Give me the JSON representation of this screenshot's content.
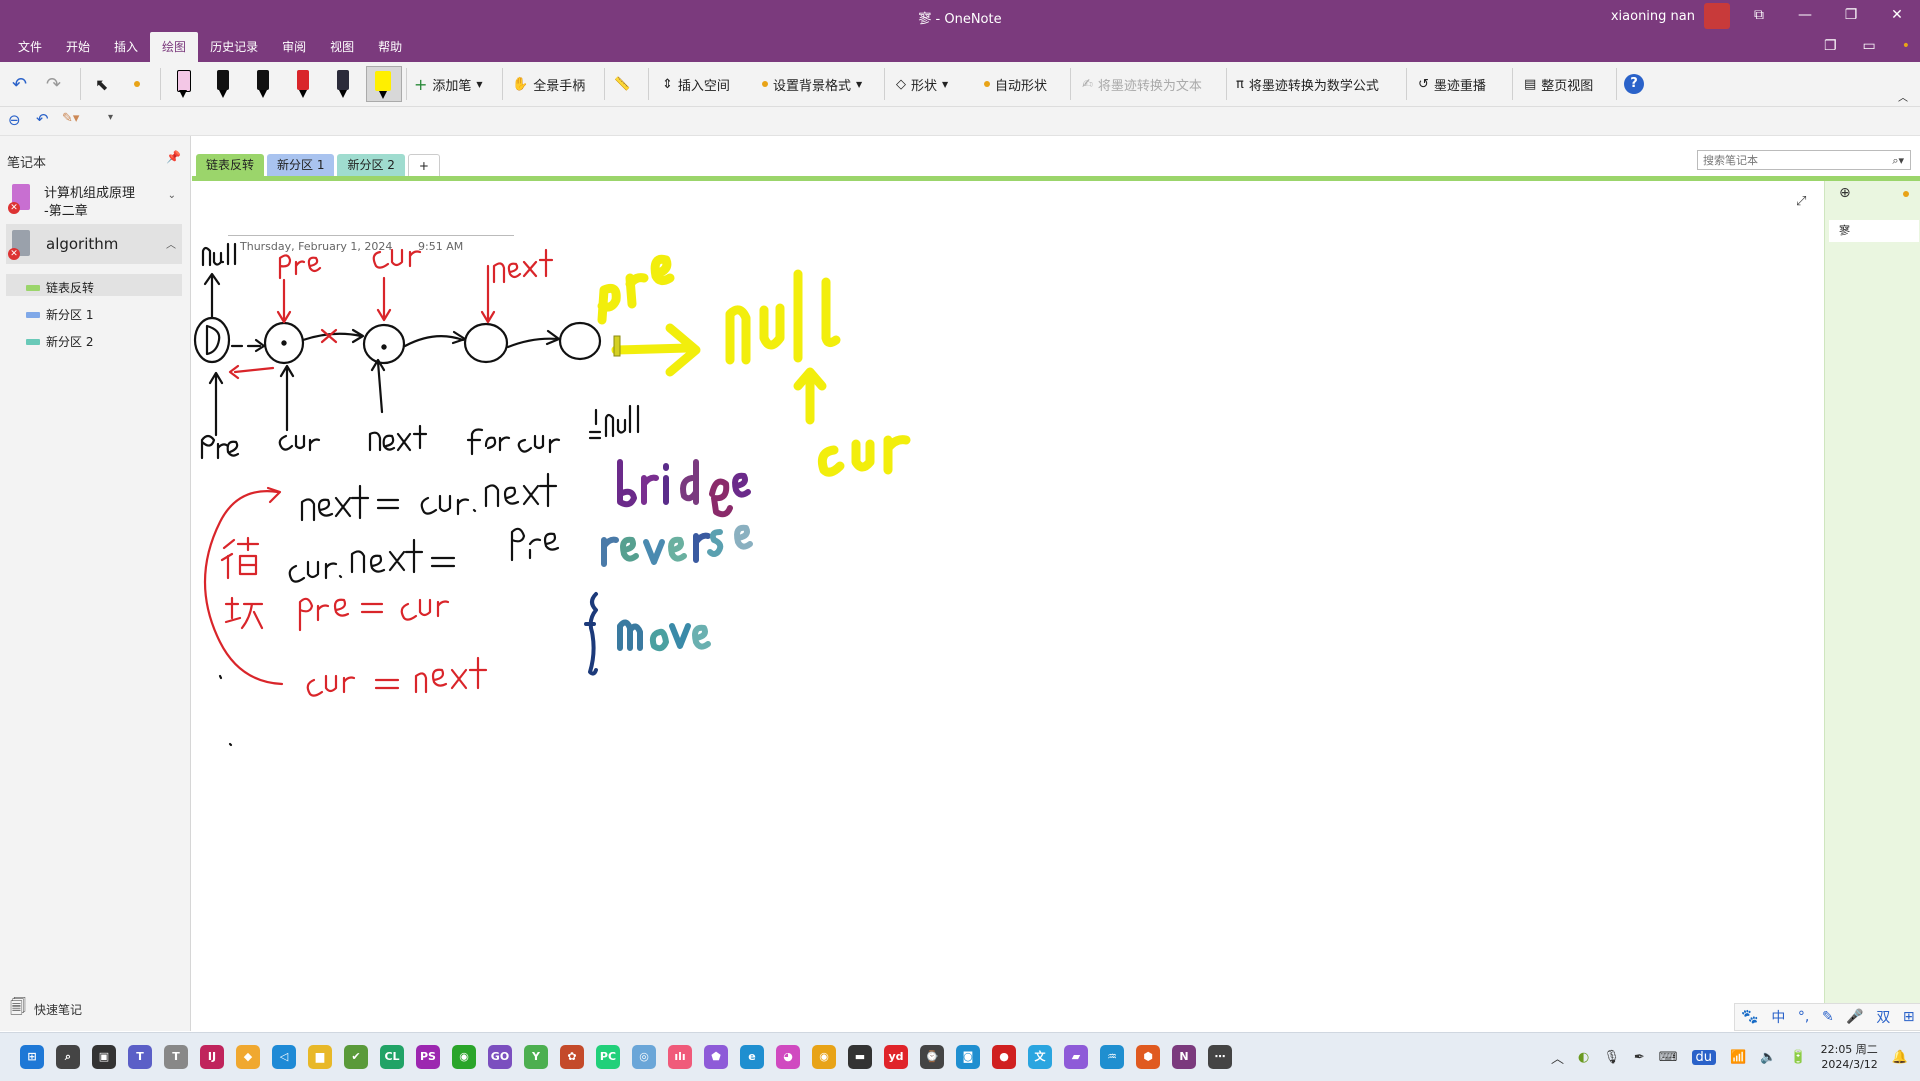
{
  "window": {
    "title": "寥 - OneNote",
    "user": "xiaoning nan",
    "controls": [
      "⧉",
      "—",
      "❐",
      "✕"
    ]
  },
  "menu": {
    "tabs": [
      "文件",
      "开始",
      "插入",
      "绘图",
      "历史记录",
      "审阅",
      "视图",
      "帮助"
    ],
    "active_index": 3
  },
  "ribbon": {
    "add_pen": "添加笔",
    "full_hand": "全景手柄",
    "insert_space": "插入空间",
    "bg_format": "设置背景格式",
    "shapes": "形状",
    "auto_shapes": "自动形状",
    "ink_to_text": "将墨迹转换为文本",
    "ink_to_math": "将墨迹转换为数学公式",
    "ink_replay": "墨迹重播",
    "page_view": "整页视图",
    "help": "?"
  },
  "sidebar": {
    "header": "笔记本",
    "notebooks": [
      {
        "name_line1": "计算机组成原理",
        "name_line2": "-第二章",
        "color": "#c86fd1"
      },
      {
        "name": "algorithm",
        "color": "#9aa1ab"
      }
    ],
    "sections": [
      {
        "label": "链表反转",
        "color": "#9bd56b"
      },
      {
        "label": "新分区 1",
        "color": "#7fa8e8"
      },
      {
        "label": "新分区 2",
        "color": "#69c9b8"
      }
    ],
    "quick_notes": "快速笔记"
  },
  "section_tabs": [
    {
      "label": "链表反转",
      "bg": "#9bd56b"
    },
    {
      "label": "新分区 1",
      "bg": "#a9c3ef"
    },
    {
      "label": "新分区 2",
      "bg": "#9fdccf"
    },
    {
      "label": "+",
      "bg": "#ffffff"
    }
  ],
  "search": {
    "placeholder": "搜索笔记本"
  },
  "page": {
    "date": "Thursday, February 1, 2024",
    "time": "9:51 AM"
  },
  "page_list": {
    "add": "⊕",
    "pages": [
      "寥"
    ]
  },
  "ime": [
    "🐾",
    "中",
    "°,",
    "✎",
    "🎤",
    "双",
    "⊞"
  ],
  "taskbar": {
    "time": "22:05 周二",
    "date": "2024/3/12",
    "apps": [
      {
        "label": "⊞",
        "color": "#1e78d6"
      },
      {
        "label": "⌕",
        "color": "#444444"
      },
      {
        "label": "▣",
        "color": "#333333"
      },
      {
        "label": "T",
        "color": "#5b5fc7"
      },
      {
        "label": "T",
        "color": "#888888"
      },
      {
        "label": "IJ",
        "color": "#c0245c"
      },
      {
        "label": "◆",
        "color": "#f0a830"
      },
      {
        "label": "◁",
        "color": "#1e8ad6"
      },
      {
        "label": "▆",
        "color": "#e8b828"
      },
      {
        "label": "✔",
        "color": "#5a9a3a"
      },
      {
        "label": "CL",
        "color": "#21a366"
      },
      {
        "label": "PS",
        "color": "#9c27b0"
      },
      {
        "label": "◉",
        "color": "#2aa52a"
      },
      {
        "label": "GO",
        "color": "#7b4fbf"
      },
      {
        "label": "Y",
        "color": "#4caf50"
      },
      {
        "label": "✿",
        "color": "#c44a2a"
      },
      {
        "label": "PC",
        "color": "#21d07a"
      },
      {
        "label": "◎",
        "color": "#6aa6d8"
      },
      {
        "label": "ılı",
        "color": "#f05a7a"
      },
      {
        "label": "⬟",
        "color": "#8e5bd8"
      },
      {
        "label": "e",
        "color": "#1f8fd0"
      },
      {
        "label": "◕",
        "color": "#d04ac0"
      },
      {
        "label": "◉",
        "color": "#e8a317"
      },
      {
        "label": "▬",
        "color": "#333333"
      },
      {
        "label": "yd",
        "color": "#e0242a"
      },
      {
        "label": "⌚",
        "color": "#444444"
      },
      {
        "label": "◙",
        "color": "#1f8fd0"
      },
      {
        "label": "●",
        "color": "#d02020"
      },
      {
        "label": "文",
        "color": "#2aa5e0"
      },
      {
        "label": "▰",
        "color": "#8e5bd8"
      },
      {
        "label": "♒",
        "color": "#1f8fd0"
      },
      {
        "label": "⬢",
        "color": "#e05a20"
      },
      {
        "label": "N",
        "color": "#7b3a7d"
      },
      {
        "label": "⋯",
        "color": "#444444"
      }
    ]
  }
}
